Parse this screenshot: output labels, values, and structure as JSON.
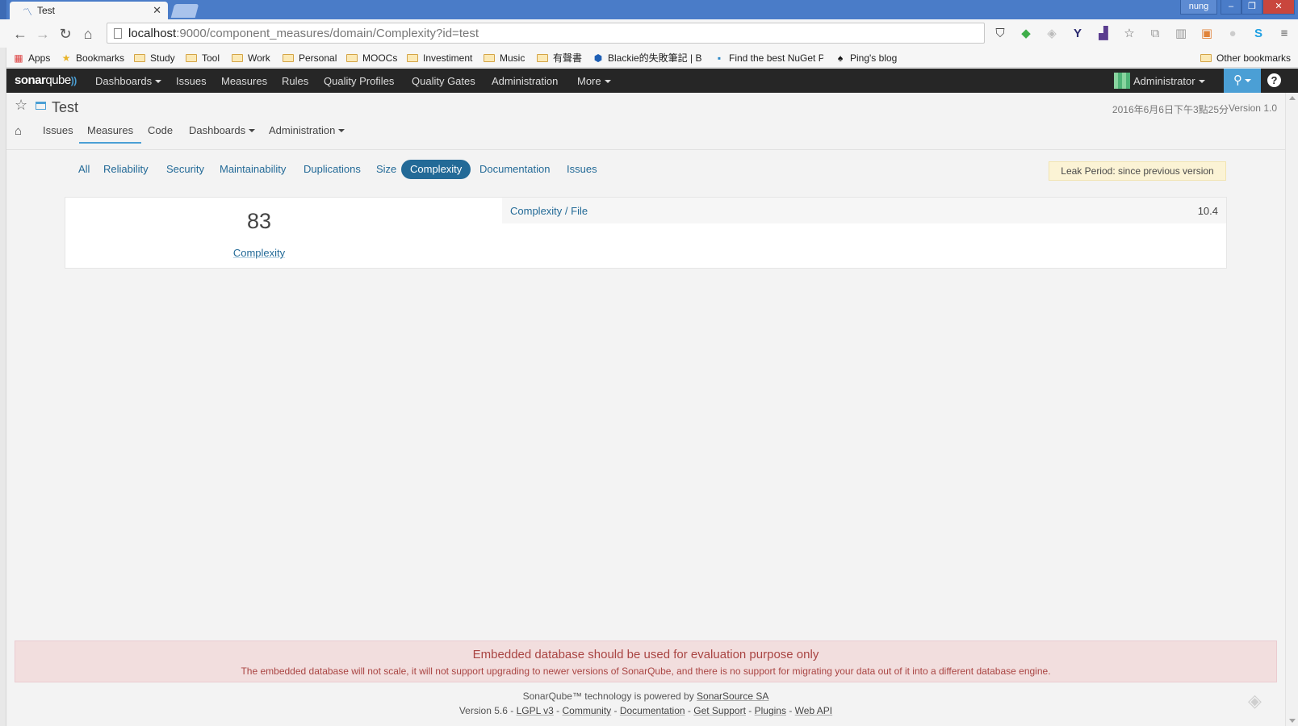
{
  "browser": {
    "tab_title": "Test",
    "user": "nung",
    "url_host": "localhost",
    "url_path": ":9000/component_measures/domain/Complexity?id=test",
    "bookmarks": [
      {
        "label": "Apps",
        "icon": "apps-grid-icon"
      },
      {
        "label": "Bookmarks",
        "icon": "star-icon"
      },
      {
        "label": "Study",
        "icon": "folder-icon"
      },
      {
        "label": "Tool",
        "icon": "folder-icon"
      },
      {
        "label": "Work",
        "icon": "folder-icon"
      },
      {
        "label": "Personal",
        "icon": "folder-icon"
      },
      {
        "label": "MOOCs",
        "icon": "folder-icon"
      },
      {
        "label": "Investiment",
        "icon": "folder-icon"
      },
      {
        "label": "Music",
        "icon": "folder-icon"
      },
      {
        "label": "有聲書",
        "icon": "folder-icon"
      },
      {
        "label": "Blackie的失敗筆記 | Bl",
        "icon": "site-icon"
      },
      {
        "label": "Find the best NuGet P",
        "icon": "nuget-icon"
      },
      {
        "label": "Ping's blog",
        "icon": "spade-icon"
      }
    ],
    "other_bookmarks": "Other bookmarks"
  },
  "sonar_nav": {
    "logo_bold": "sonar",
    "logo_light": "qube",
    "items": [
      "Dashboards",
      "Issues",
      "Measures",
      "Rules",
      "Quality Profiles",
      "Quality Gates",
      "Administration",
      "More"
    ],
    "user": "Administrator"
  },
  "component": {
    "name": "Test",
    "analysis_date": "2016年6月6日下午3點25分",
    "version": "Version 1.0",
    "tabs": [
      "Issues",
      "Measures",
      "Code",
      "Dashboards",
      "Administration"
    ],
    "active_tab": "Measures"
  },
  "domains": {
    "tabs": [
      "All",
      "Reliability",
      "Security",
      "Maintainability",
      "Duplications",
      "Size",
      "Complexity",
      "Documentation",
      "Issues"
    ],
    "active": "Complexity",
    "leak_period": "Leak Period: since previous version"
  },
  "measures": {
    "main_value": "83",
    "main_label": "Complexity",
    "sub_label": "Complexity / File",
    "sub_value": "10.4"
  },
  "warning": {
    "title": "Embedded database should be used for evaluation purpose only",
    "text": "The embedded database will not scale, it will not support upgrading to newer versions of SonarQube, and there is no support for migrating your data out of it into a different database engine."
  },
  "footer": {
    "line1_prefix": "SonarQube™ technology is powered by ",
    "line1_link": "SonarSource SA",
    "version": "Version 5.6",
    "links": [
      "LGPL v3",
      "Community",
      "Documentation",
      "Get Support",
      "Plugins",
      "Web API"
    ]
  },
  "colors": {
    "sonar_nav_bg": "#262626",
    "accent": "#236a97",
    "search_bg": "#4b9fd5",
    "leak_bg": "#fbf3d5",
    "warning_bg": "#f2dede",
    "warning_text": "#a94442"
  }
}
